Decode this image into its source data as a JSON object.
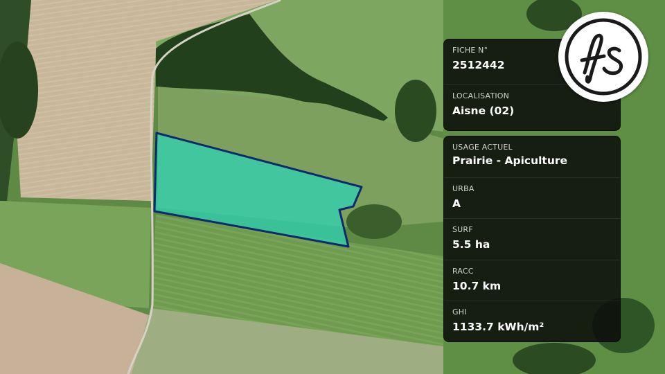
{
  "map": {
    "parcel_fill": "#2fd1b0",
    "parcel_outline": "#0b2a6b"
  },
  "card_top": [
    {
      "label": "FICHE N°",
      "value": "2512442"
    },
    {
      "label": "LOCALISATION",
      "value": "Aisne (02)"
    }
  ],
  "card_details": [
    {
      "label": "USAGE ACTUEL",
      "value": "Prairie - Apiculture"
    },
    {
      "label": "URBA",
      "value": "A"
    },
    {
      "label": "SURF",
      "value": "5.5 ha"
    },
    {
      "label": "RACC",
      "value": "10.7 km"
    },
    {
      "label": "GHI",
      "value": "1133.7 kWh/m²"
    }
  ],
  "logo": {
    "text": "fs",
    "icon": "fs-logo-icon"
  }
}
